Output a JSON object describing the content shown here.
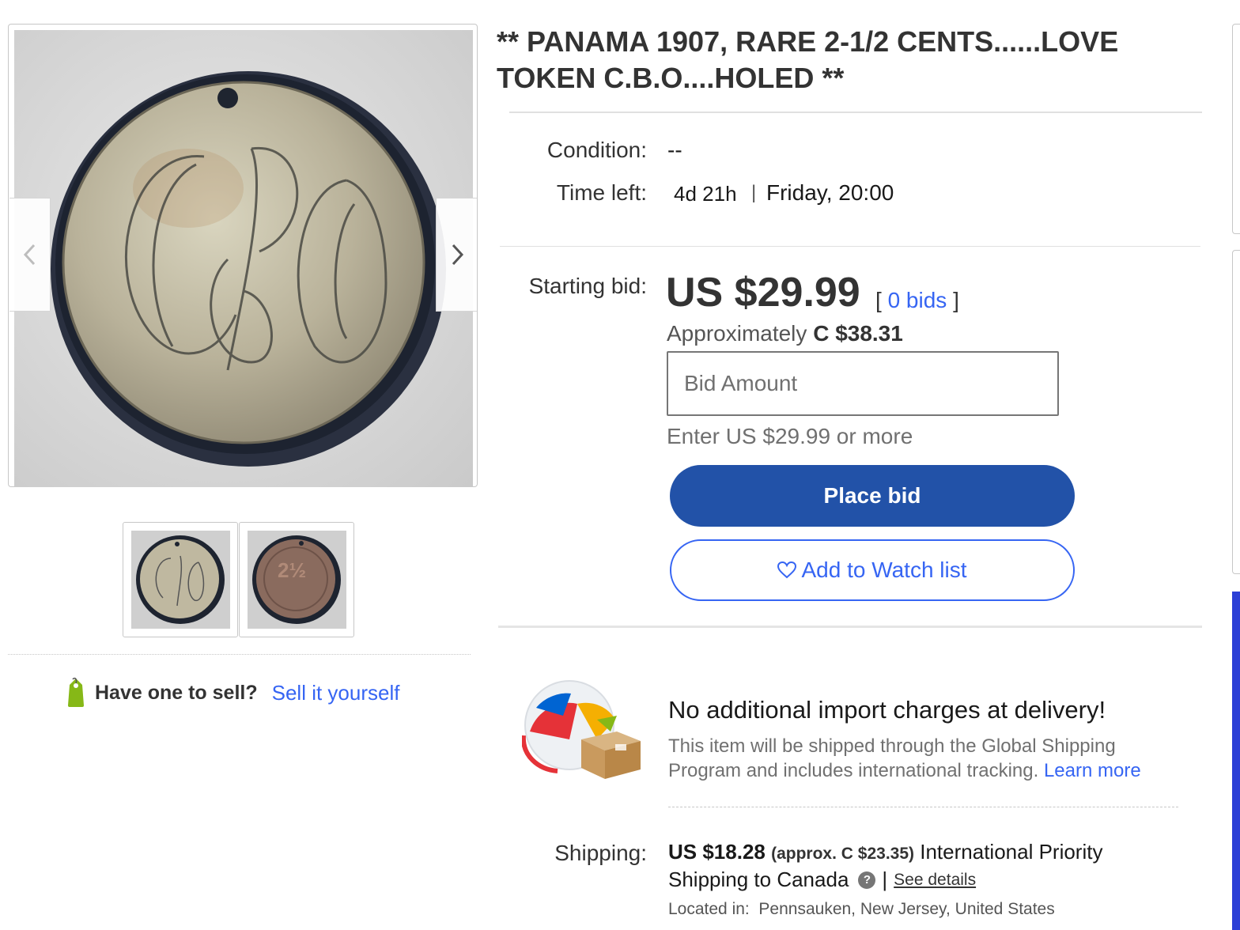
{
  "gallery": {
    "prev_label": "‹",
    "next_label": "›",
    "main_image_monogram": "CBO",
    "thumb_2_mark": "2½"
  },
  "sell": {
    "label": "Have one to sell?",
    "link": "Sell it yourself"
  },
  "item": {
    "title": "** PANAMA 1907, RARE 2-1/2 CENTS......LOVE TOKEN C.B.O....HOLED **"
  },
  "details": {
    "condition_label": "Condition:",
    "condition_value": "--",
    "time_left_label": "Time left:",
    "time_left_value": "4d 21h",
    "time_separator": "|",
    "end_day": "Friday, 20:00"
  },
  "bidding": {
    "label": "Starting bid:",
    "price": "US $29.99",
    "bids_open": "[",
    "bids_link": "0 bids",
    "bids_close": "]",
    "approx_prefix": "Approximately",
    "approx_value": "C $38.31",
    "input_placeholder": "Bid Amount",
    "hint": "Enter US $29.99 or more",
    "place_bid_label": "Place bid",
    "watch_label": "Add to Watch list"
  },
  "shipping": {
    "gsp_title": "No additional import charges at delivery!",
    "gsp_desc": "This item will be shipped through the Global Shipping Program and includes international tracking.",
    "learn_more": "Learn more",
    "label": "Shipping:",
    "cost": "US $18.28",
    "approx": "(approx. C $23.35)",
    "method_a": "International Priority",
    "method_b": "Shipping to Canada",
    "help_glyph": "?",
    "pipe": "|",
    "see_details": "See details",
    "located_label": "Located in:",
    "located_value": "Pennsauken, New Jersey, United States"
  },
  "colors": {
    "link": "#3665f3",
    "primary_button": "#2252a8",
    "text": "#333333",
    "muted": "#707070"
  }
}
